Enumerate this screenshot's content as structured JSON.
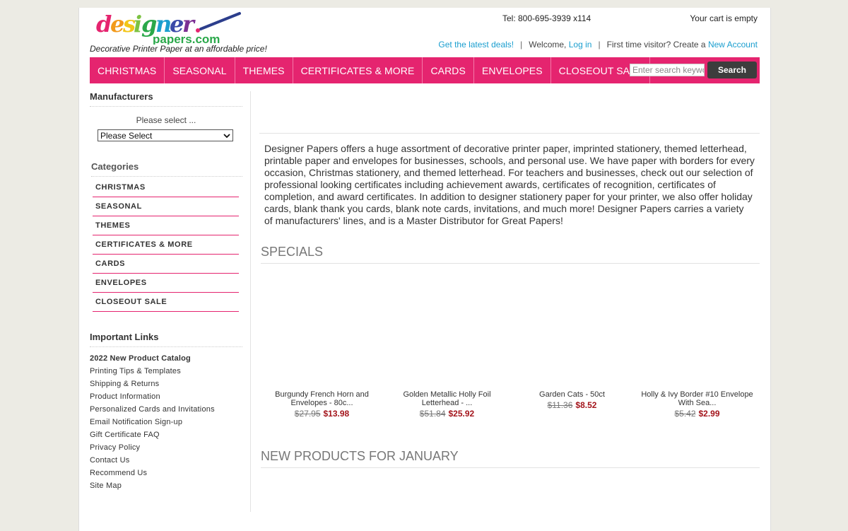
{
  "header": {
    "tagline": "Decorative Printer Paper at an affordable price!",
    "phone": "Tel: 800-695-3939 x114",
    "cart": "Your cart is empty",
    "deals_link": "Get the latest deals!",
    "welcome_text": "Welcome,",
    "login_link": "Log in",
    "first_time_text": "First time visitor? Create a",
    "new_account_link": "New Account",
    "separator": "|"
  },
  "nav": {
    "items": [
      "CHRISTMAS",
      "SEASONAL",
      "THEMES",
      "CERTIFICATES & MORE",
      "CARDS",
      "ENVELOPES",
      "CLOSEOUT SALE"
    ],
    "search_placeholder": "Enter search keywords here",
    "search_button": "Search"
  },
  "sidebar": {
    "manufacturers_heading": "Manufacturers",
    "manufacturers_label": "Please select ...",
    "manufacturers_selected": "Please Select",
    "categories_heading": "Categories",
    "categories": [
      "CHRISTMAS",
      "SEASONAL",
      "THEMES",
      "CERTIFICATES & MORE",
      "CARDS",
      "ENVELOPES",
      "CLOSEOUT SALE"
    ],
    "important_heading": "Important Links",
    "links": [
      "2022 New Product Catalog",
      "Printing Tips & Templates",
      "Shipping & Returns",
      "Product Information",
      "Personalized Cards and Invitations",
      "Email Notification Sign-up",
      "Gift Certificate FAQ",
      "Privacy Policy",
      "Contact Us",
      "Recommend Us",
      "Site Map"
    ]
  },
  "main": {
    "intro": "Designer Papers offers a huge assortment of decorative printer paper, imprinted stationery, themed letterhead, printable paper and envelopes for businesses, schools, and personal use. We have paper with borders for every occasion, Christmas stationery, and themed letterhead. For teachers and businesses, check out our selection of professional looking certificates including achievement awards, certificates of recognition, certificates of completion, and award certificates. In addition to designer stationery paper for your printer, we also offer holiday cards, blank thank you cards, blank note cards, invitations, and much more! Designer Papers carries a variety of manufacturers' lines, and is a Master Distributor for Great Papers!",
    "specials_heading": "SPECIALS",
    "specials": [
      {
        "name": "Burgundy French Horn and Envelopes - 80c...",
        "old_price": "$27.95",
        "new_price": "$13.98"
      },
      {
        "name": "Golden Metallic Holly Foil Letterhead - ...",
        "old_price": "$51.84",
        "new_price": "$25.92"
      },
      {
        "name": "Garden Cats - 50ct",
        "old_price": "$11.36",
        "new_price": "$8.52"
      },
      {
        "name": "Holly & Ivy Border #10 Envelope With Sea...",
        "old_price": "$5.42",
        "new_price": "$2.99"
      }
    ],
    "new_products_heading": "NEW PRODUCTS FOR JANUARY"
  },
  "colors": {
    "nav_bg": "#e5246f",
    "link": "#1a9ecf",
    "sale_price": "#a3141b"
  }
}
